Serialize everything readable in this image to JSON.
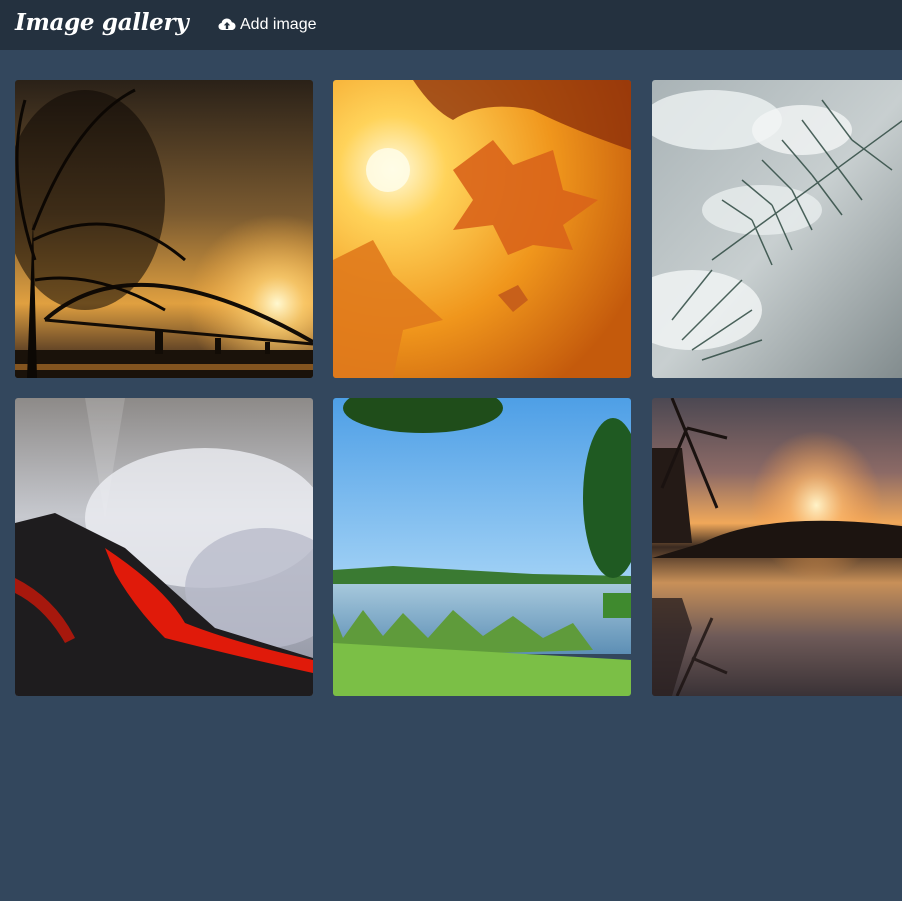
{
  "header": {
    "title": "Image gallery",
    "add_button_label": "Add image",
    "add_button_icon": "cloud-upload-icon",
    "background": "#24313f"
  },
  "page": {
    "background": "#33475d"
  },
  "gallery": {
    "images": [
      {
        "subject": "bridge-sunset"
      },
      {
        "subject": "autumn-leaves"
      },
      {
        "subject": "snowy-pine"
      },
      {
        "subject": "lava-flow"
      },
      {
        "subject": "lake-shore"
      },
      {
        "subject": "windmill-sunset"
      }
    ]
  }
}
